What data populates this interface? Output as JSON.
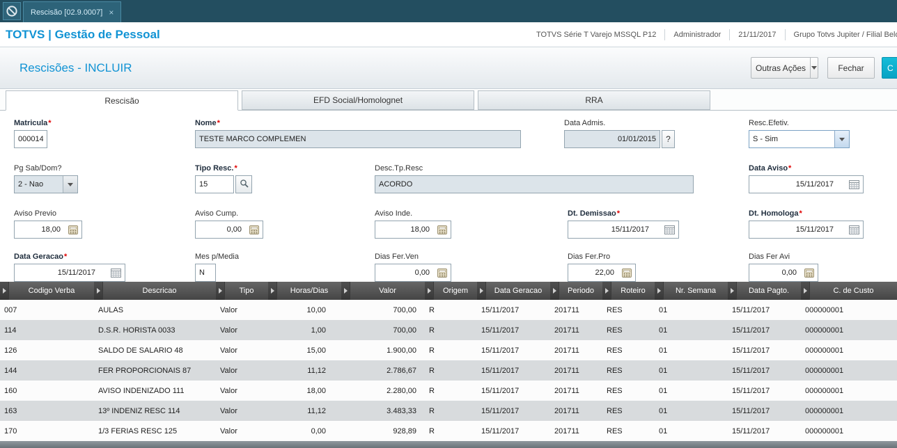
{
  "topbar": {
    "tab_title": "Rescisão [02.9.0007]",
    "close_glyph": "×"
  },
  "appbar": {
    "brand": "TOTVS | Gestão de Pessoal",
    "environment": "TOTVS Série T Varejo MSSQL P12",
    "user": "Administrador",
    "date": "21/11/2017",
    "company": "Grupo Totvs Jupiter / Filial Belo Hor"
  },
  "page": {
    "title": "Rescisões - INCLUIR",
    "outras_acoes_label": "Outras Ações",
    "fechar_label": "Fechar",
    "confirm_label": "C"
  },
  "tabs": {
    "rescisao": "Rescisão",
    "efd": "EFD Social/Homolognet",
    "rra": "RRA"
  },
  "form": {
    "required_mark": "*",
    "help_glyph": "?",
    "matricula": {
      "label": "Matricula",
      "value": "000014"
    },
    "nome": {
      "label": "Nome",
      "value": "TESTE MARCO COMPLEMEN"
    },
    "data_admis": {
      "label": "Data Admis.",
      "value": "01/01/2015"
    },
    "resc_efetiv": {
      "label": "Resc.Efetiv.",
      "value": "S - Sim"
    },
    "pg_sab_dom": {
      "label": "Pg Sab/Dom?",
      "value": "2 - Nao"
    },
    "tipo_resc": {
      "label": "Tipo Resc.",
      "value": "15"
    },
    "desc_tp_resc": {
      "label": "Desc.Tp.Resc",
      "value": "ACORDO"
    },
    "data_aviso": {
      "label": "Data Aviso",
      "value": "15/11/2017"
    },
    "aviso_previo": {
      "label": "Aviso Previo",
      "value": "18,00"
    },
    "aviso_cump": {
      "label": "Aviso Cump.",
      "value": "0,00"
    },
    "aviso_inde": {
      "label": "Aviso Inde.",
      "value": "18,00"
    },
    "dt_demissao": {
      "label": "Dt. Demissao",
      "value": "15/11/2017"
    },
    "dt_homologa": {
      "label": "Dt. Homologa",
      "value": "15/11/2017"
    },
    "data_geracao": {
      "label": "Data Geracao",
      "value": "15/11/2017"
    },
    "mes_p_media": {
      "label": "Mes p/Media",
      "value": "N"
    },
    "dias_fer_ven": {
      "label": "Dias Fer.Ven",
      "value": "0,00"
    },
    "dias_fer_pro": {
      "label": "Dias Fer.Pro",
      "value": "22,00"
    },
    "dias_fer_avi": {
      "label": "Dias Fer Avi",
      "value": "0,00"
    }
  },
  "grid": {
    "columns": [
      "Codigo Verba",
      "Descricao",
      "Tipo",
      "Horas/Dias",
      "Valor",
      "Origem",
      "Data Geracao",
      "Periodo",
      "Roteiro",
      "Nr. Semana",
      "Data Pagto.",
      "C. de Custo"
    ],
    "rows": [
      [
        "007",
        "AULAS",
        "Valor",
        "10,00",
        "700,00",
        "R",
        "15/11/2017",
        "201711",
        "RES",
        "01",
        "15/11/2017",
        "000000001"
      ],
      [
        "114",
        "D.S.R. HORISTA 0033",
        "Valor",
        "1,00",
        "700,00",
        "R",
        "15/11/2017",
        "201711",
        "RES",
        "01",
        "15/11/2017",
        "000000001"
      ],
      [
        "126",
        "SALDO DE SALARIO 48",
        "Valor",
        "15,00",
        "1.900,00",
        "R",
        "15/11/2017",
        "201711",
        "RES",
        "01",
        "15/11/2017",
        "000000001"
      ],
      [
        "144",
        "FER PROPORCIONAIS 87",
        "Valor",
        "11,12",
        "2.786,67",
        "R",
        "15/11/2017",
        "201711",
        "RES",
        "01",
        "15/11/2017",
        "000000001"
      ],
      [
        "160",
        "AVISO INDENIZADO 111",
        "Valor",
        "18,00",
        "2.280,00",
        "R",
        "15/11/2017",
        "201711",
        "RES",
        "01",
        "15/11/2017",
        "000000001"
      ],
      [
        "163",
        "13º INDENIZ RESC 114",
        "Valor",
        "11,12",
        "3.483,33",
        "R",
        "15/11/2017",
        "201711",
        "RES",
        "01",
        "15/11/2017",
        "000000001"
      ],
      [
        "170",
        "1/3 FERIAS RESC 125",
        "Valor",
        "0,00",
        "928,89",
        "R",
        "15/11/2017",
        "201711",
        "RES",
        "01",
        "15/11/2017",
        "000000001"
      ]
    ]
  }
}
